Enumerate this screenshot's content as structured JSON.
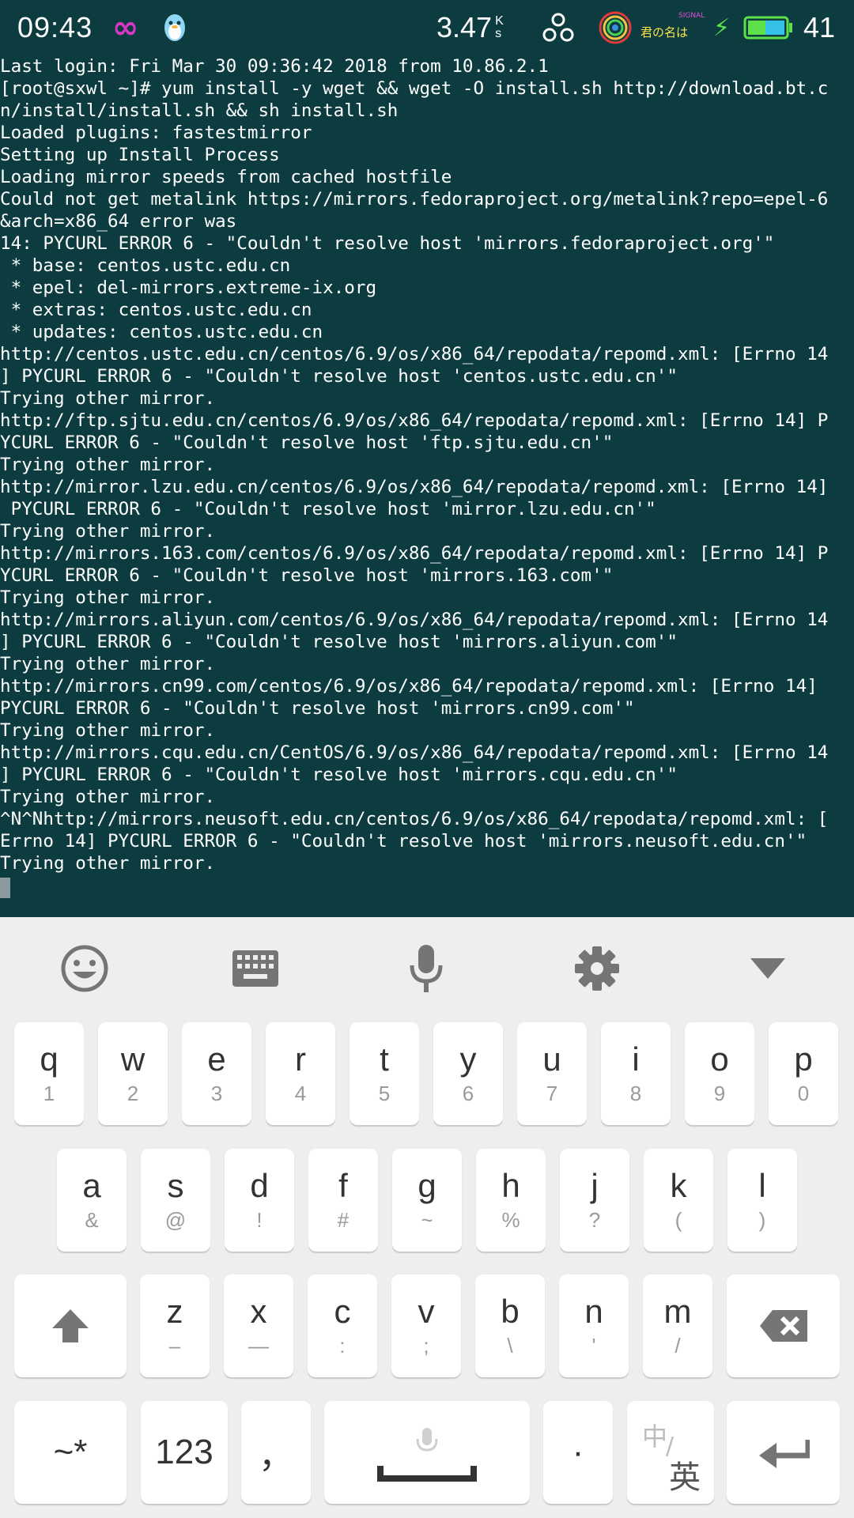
{
  "status_bar": {
    "time": "09:43",
    "net_speed": "3.47",
    "net_speed_unit_top": "K",
    "net_speed_unit_bottom": "s",
    "signal_text": "SIGNAL",
    "song_text": "君の名は",
    "battery_level": "41",
    "icons": [
      "infinity-icon",
      "qq-penguin-icon",
      "network-icon",
      "signal-art-icon",
      "charging-bolt-icon",
      "battery-icon"
    ]
  },
  "terminal": {
    "lines": [
      "Last login: Fri Mar 30 09:36:42 2018 from 10.86.2.1",
      "[root@sxwl ~]# yum install -y wget && wget -O install.sh http://download.bt.c",
      "n/install/install.sh && sh install.sh",
      "Loaded plugins: fastestmirror",
      "Setting up Install Process",
      "Loading mirror speeds from cached hostfile",
      "Could not get metalink https://mirrors.fedoraproject.org/metalink?repo=epel-6",
      "&arch=x86_64 error was",
      "14: PYCURL ERROR 6 - \"Couldn't resolve host 'mirrors.fedoraproject.org'\"",
      " * base: centos.ustc.edu.cn",
      " * epel: del-mirrors.extreme-ix.org",
      " * extras: centos.ustc.edu.cn",
      " * updates: centos.ustc.edu.cn",
      "http://centos.ustc.edu.cn/centos/6.9/os/x86_64/repodata/repomd.xml: [Errno 14",
      "] PYCURL ERROR 6 - \"Couldn't resolve host 'centos.ustc.edu.cn'\"",
      "Trying other mirror.",
      "http://ftp.sjtu.edu.cn/centos/6.9/os/x86_64/repodata/repomd.xml: [Errno 14] P",
      "YCURL ERROR 6 - \"Couldn't resolve host 'ftp.sjtu.edu.cn'\"",
      "Trying other mirror.",
      "http://mirror.lzu.edu.cn/centos/6.9/os/x86_64/repodata/repomd.xml: [Errno 14]",
      " PYCURL ERROR 6 - \"Couldn't resolve host 'mirror.lzu.edu.cn'\"",
      "Trying other mirror.",
      "http://mirrors.163.com/centos/6.9/os/x86_64/repodata/repomd.xml: [Errno 14] P",
      "YCURL ERROR 6 - \"Couldn't resolve host 'mirrors.163.com'\"",
      "Trying other mirror.",
      "http://mirrors.aliyun.com/centos/6.9/os/x86_64/repodata/repomd.xml: [Errno 14",
      "] PYCURL ERROR 6 - \"Couldn't resolve host 'mirrors.aliyun.com'\"",
      "Trying other mirror.",
      "http://mirrors.cn99.com/centos/6.9/os/x86_64/repodata/repomd.xml: [Errno 14]",
      "PYCURL ERROR 6 - \"Couldn't resolve host 'mirrors.cn99.com'\"",
      "Trying other mirror.",
      "http://mirrors.cqu.edu.cn/CentOS/6.9/os/x86_64/repodata/repomd.xml: [Errno 14",
      "] PYCURL ERROR 6 - \"Couldn't resolve host 'mirrors.cqu.edu.cn'\"",
      "Trying other mirror.",
      "^N^Nhttp://mirrors.neusoft.edu.cn/centos/6.9/os/x86_64/repodata/repomd.xml: [",
      "Errno 14] PYCURL ERROR 6 - \"Couldn't resolve host 'mirrors.neusoft.edu.cn'\"",
      "Trying other mirror."
    ]
  },
  "keyboard": {
    "toolbar": [
      "emoji-icon",
      "keyboard-icon",
      "microphone-icon",
      "gear-icon",
      "hide-keyboard-icon"
    ],
    "row1": [
      {
        "main": "q",
        "sub": "1"
      },
      {
        "main": "w",
        "sub": "2"
      },
      {
        "main": "e",
        "sub": "3"
      },
      {
        "main": "r",
        "sub": "4"
      },
      {
        "main": "t",
        "sub": "5"
      },
      {
        "main": "y",
        "sub": "6"
      },
      {
        "main": "u",
        "sub": "7"
      },
      {
        "main": "i",
        "sub": "8"
      },
      {
        "main": "o",
        "sub": "9"
      },
      {
        "main": "p",
        "sub": "0"
      }
    ],
    "row2": [
      {
        "main": "a",
        "sub": "&"
      },
      {
        "main": "s",
        "sub": "@"
      },
      {
        "main": "d",
        "sub": "!"
      },
      {
        "main": "f",
        "sub": "#"
      },
      {
        "main": "g",
        "sub": "~"
      },
      {
        "main": "h",
        "sub": "%"
      },
      {
        "main": "j",
        "sub": "?"
      },
      {
        "main": "k",
        "sub": "("
      },
      {
        "main": "l",
        "sub": ")"
      }
    ],
    "row3": [
      {
        "main": "z",
        "sub": "–"
      },
      {
        "main": "x",
        "sub": "—"
      },
      {
        "main": "c",
        "sub": ":"
      },
      {
        "main": "v",
        "sub": ";"
      },
      {
        "main": "b",
        "sub": "\\"
      },
      {
        "main": "n",
        "sub": "'"
      },
      {
        "main": "m",
        "sub": "/"
      }
    ],
    "bottom": {
      "symbols": "~*",
      "numbers": "123",
      "comma": "，",
      "period": "·",
      "lang_top": "中",
      "lang_bottom": "英"
    },
    "accent_key_color": "#333333"
  }
}
